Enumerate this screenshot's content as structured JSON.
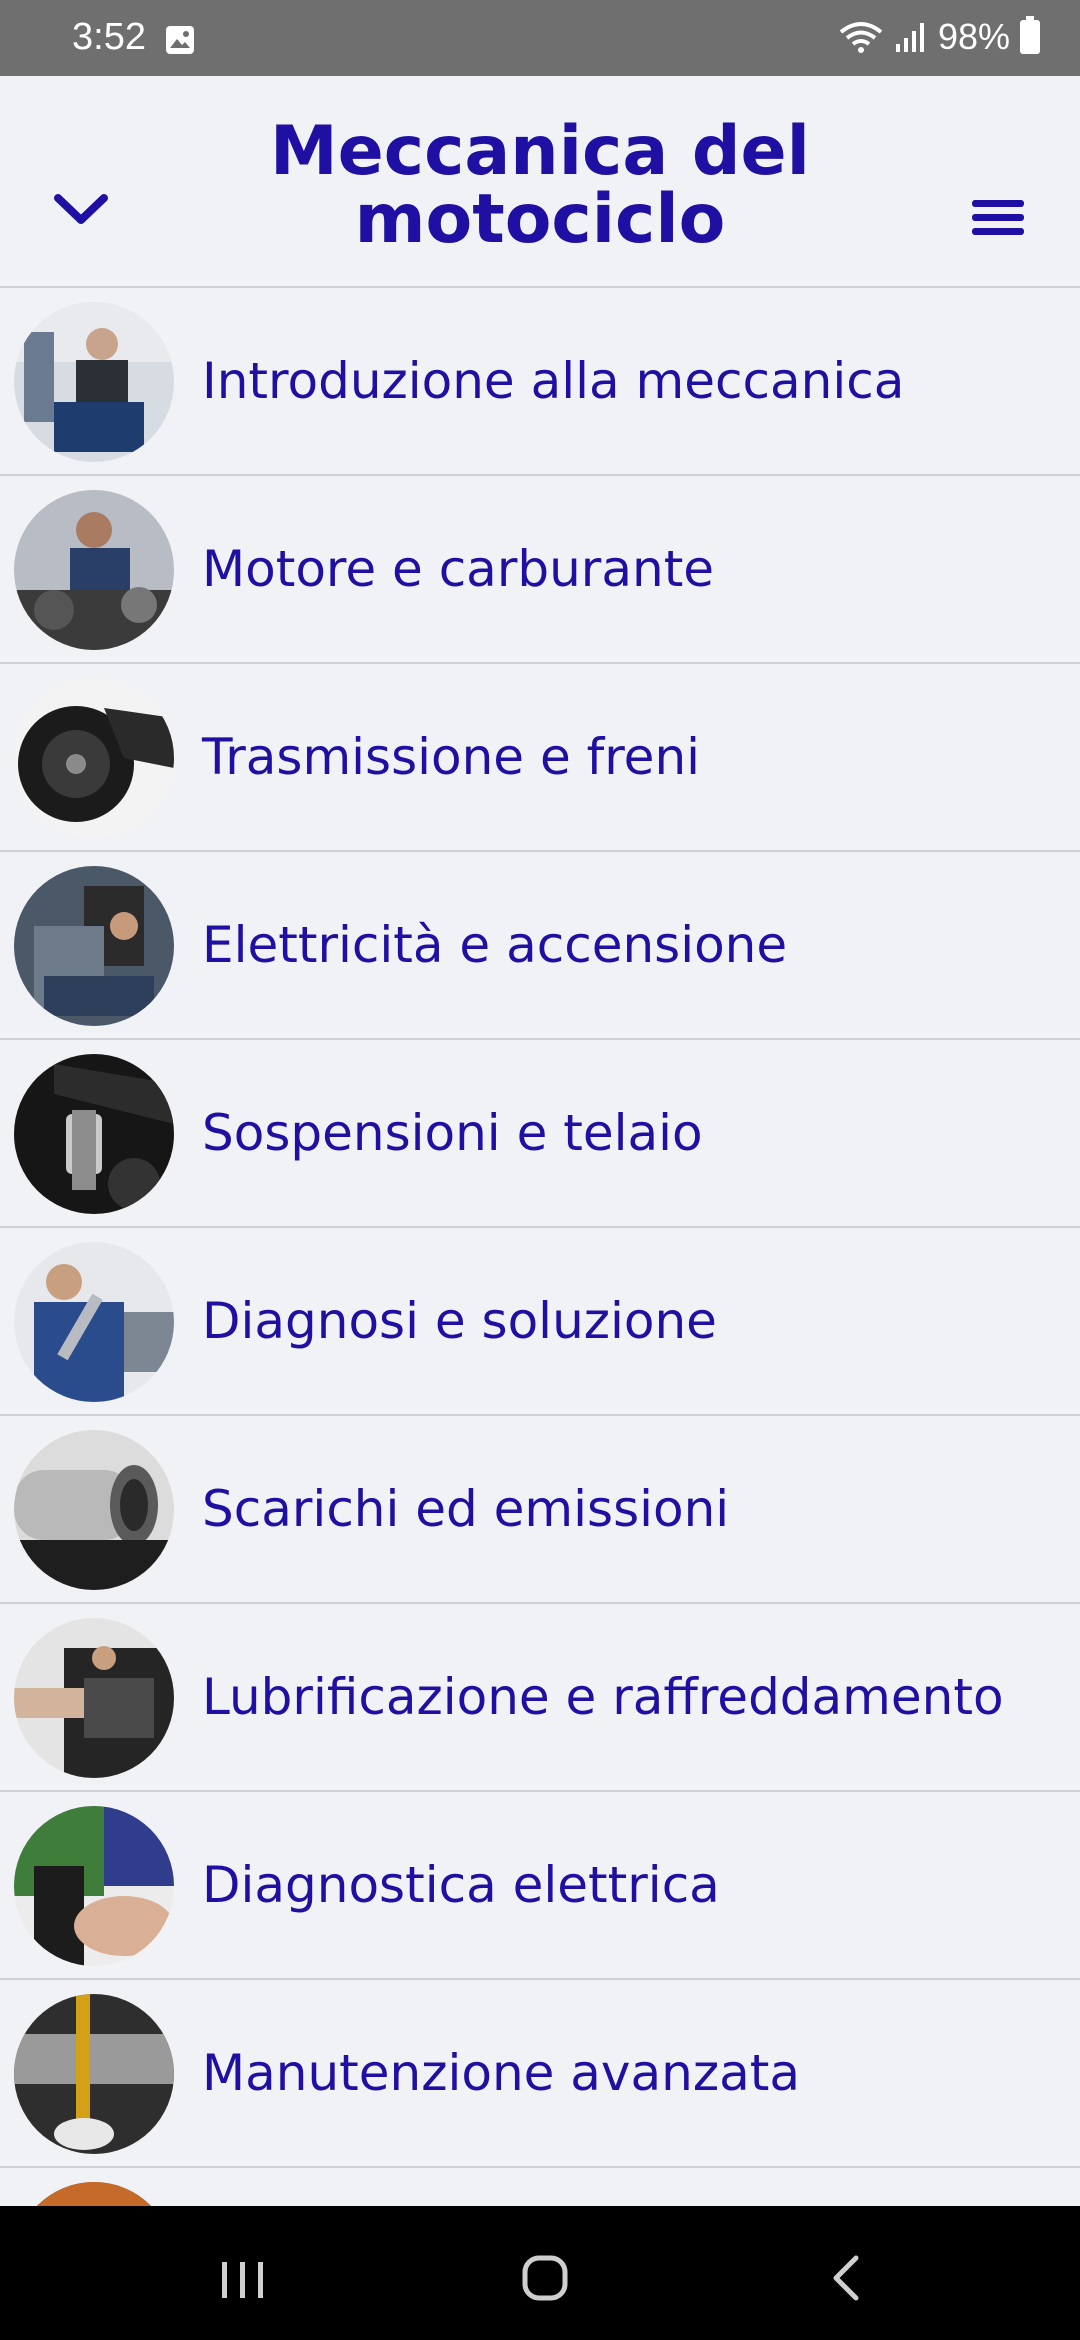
{
  "status_bar": {
    "time": "3:52",
    "battery": "98%"
  },
  "header": {
    "title": "Meccanica del motociclo"
  },
  "topics": [
    {
      "label": "Introduzione alla meccanica"
    },
    {
      "label": "Motore e carburante"
    },
    {
      "label": "Trasmissione e freni"
    },
    {
      "label": "Elettricità e accensione"
    },
    {
      "label": "Sospensioni e telaio"
    },
    {
      "label": "Diagnosi e soluzione"
    },
    {
      "label": "Scarichi ed emissioni"
    },
    {
      "label": "Lubrificazione e raffreddamento"
    },
    {
      "label": "Diagnostica elettrica"
    },
    {
      "label": "Manutenzione avanzata"
    },
    {
      "label": ""
    }
  ],
  "colors": {
    "accent": "#1f10a3",
    "background": "#f1f2f5",
    "divider": "#cfd0d4"
  }
}
